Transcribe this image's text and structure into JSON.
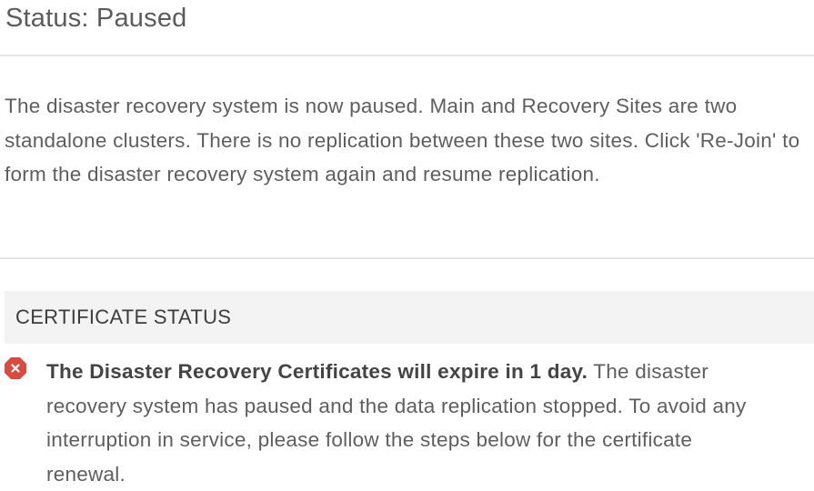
{
  "status": {
    "title": "Status: Paused"
  },
  "description": {
    "text": "The disaster recovery system is now paused. Main and Recovery Sites are two standalone clusters. There is no replication between these two sites. Click 'Re-Join' to form the disaster recovery system again and resume replication."
  },
  "certificate_section": {
    "title": "CERTIFICATE STATUS",
    "alert": {
      "icon": "error-icon",
      "icon_color": "#d94b3f",
      "headline": "The Disaster Recovery Certificates will expire in 1 day.",
      "body": "The disaster recovery system has paused and the data replication stopped. To avoid any interruption in service, please follow the steps below for the certificate renewal."
    }
  }
}
